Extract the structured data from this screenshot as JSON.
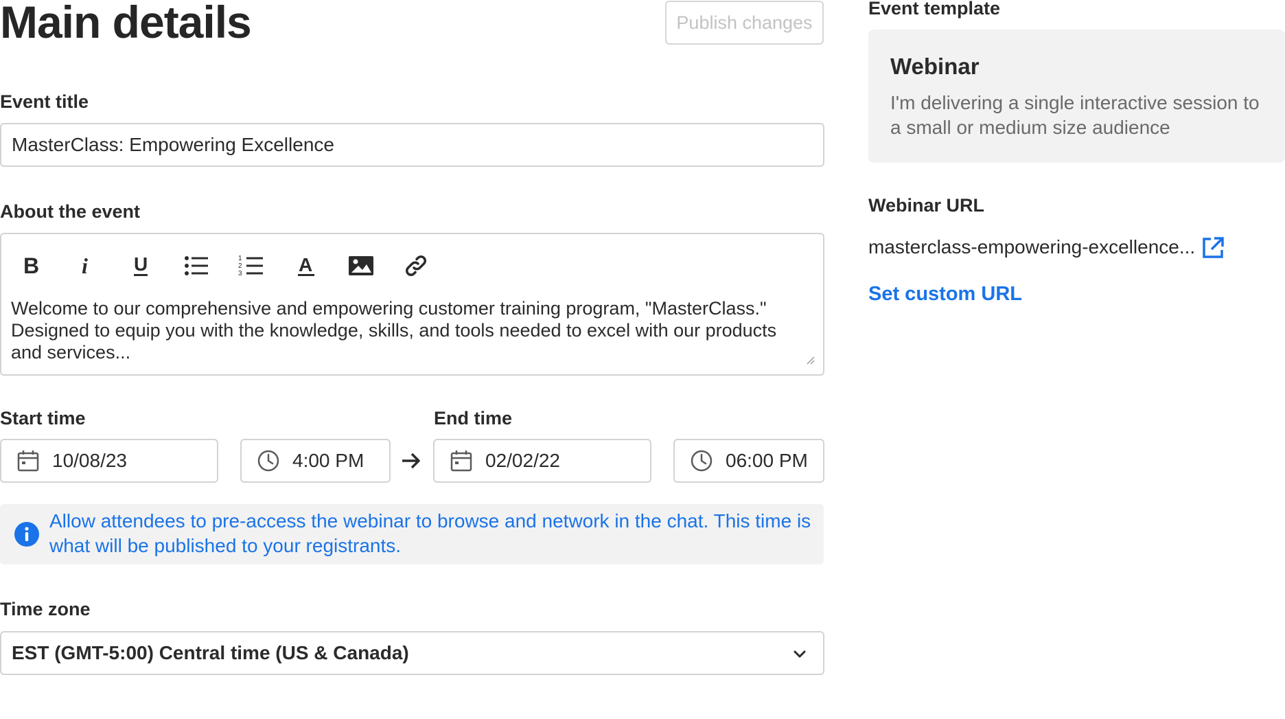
{
  "header": {
    "title": "Main details",
    "publish_label": "Publish changes"
  },
  "event_title": {
    "label": "Event title",
    "value": "MasterClass: Empowering Excellence"
  },
  "about": {
    "label": "About the event",
    "toolbar": [
      "bold-icon",
      "italic-icon",
      "underline-icon",
      "bullet-list-icon",
      "numbered-list-icon",
      "text-color-icon",
      "image-icon",
      "link-icon"
    ],
    "text": "Welcome to our comprehensive and empowering customer training program, \"MasterClass.\" Designed to equip you with the knowledge, skills, and tools needed to excel with our products and services..."
  },
  "start": {
    "label": "Start time",
    "date": "10/08/23",
    "time": "4:00 PM"
  },
  "end": {
    "label": "End time",
    "date": "02/02/22",
    "time": "06:00 PM"
  },
  "info": {
    "text": "Allow attendees to pre-access the webinar to browse and network in the chat. This time is what will be published to your registrants."
  },
  "timezone": {
    "label": "Time zone",
    "value": "EST (GMT-5:00) Central time (US & Canada)"
  },
  "template": {
    "label": "Event template",
    "name": "Webinar",
    "description": "I'm delivering a single interactive session to a small or medium size audience"
  },
  "webinar_url": {
    "label": "Webinar URL",
    "value": "masterclass-empowering-excellence...",
    "custom_label": "Set custom URL"
  },
  "colors": {
    "accent": "#1a73e8",
    "border": "#d3d3d3",
    "panel": "#f2f2f2"
  }
}
